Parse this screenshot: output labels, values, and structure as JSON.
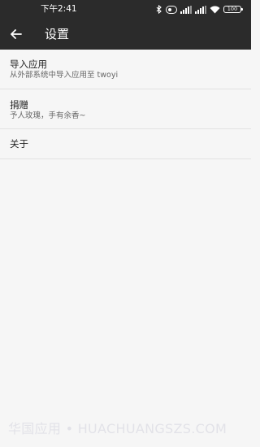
{
  "status_bar": {
    "time": "下午2:41",
    "battery": "100",
    "icons": [
      "bluetooth-icon",
      "hd-icon",
      "signal-icon",
      "signal-icon",
      "wifi-icon",
      "battery-icon"
    ]
  },
  "app_bar": {
    "back_icon": "arrow-left-icon",
    "title": "设置"
  },
  "settings": {
    "items": [
      {
        "title": "导入应用",
        "subtitle": "从外部系统中导入应用至 twoyi"
      },
      {
        "title": "捐赠",
        "subtitle": "予人玫瑰，手有余香~"
      },
      {
        "title": "关于"
      }
    ]
  },
  "watermark": "华国应用 • HUACHUANGSZS.COM"
}
